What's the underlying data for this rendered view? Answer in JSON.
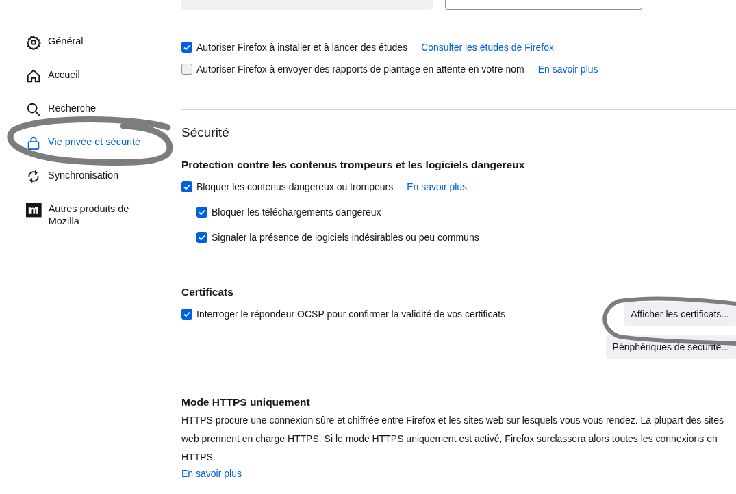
{
  "sidebar": {
    "items": [
      {
        "label": "Général",
        "kind": "gear",
        "selected": false
      },
      {
        "label": "Accueil",
        "kind": "home",
        "selected": false
      },
      {
        "label": "Recherche",
        "kind": "search",
        "selected": false
      },
      {
        "label": "Vie privée et sécurité",
        "kind": "lock",
        "selected": true
      },
      {
        "label": "Synchronisation",
        "kind": "sync",
        "selected": false
      },
      {
        "label": "Autres produits de Mozilla",
        "kind": "mozilla",
        "selected": false
      }
    ]
  },
  "data_collection": {
    "options": [
      {
        "label": "Autoriser Firefox à installer et à lancer des études",
        "checked": true,
        "link": "Consulter les études de Firefox"
      },
      {
        "label": "Autoriser Firefox à envoyer des rapports de plantage en attente en votre nom",
        "checked": false,
        "link": "En savoir plus"
      }
    ]
  },
  "security": {
    "title": "Sécurité",
    "protection": {
      "heading": "Protection contre les contenus trompeurs et les logiciels dangereux",
      "option": {
        "label": "Bloquer les contenus dangereux ou trompeurs",
        "checked": true,
        "link": "En savoir plus"
      },
      "children": [
        {
          "label": "Bloquer les téléchargements dangereux",
          "checked": true
        },
        {
          "label": "Signaler la présence de logiciels indésirables ou peu communs",
          "checked": true
        }
      ]
    },
    "certificates": {
      "heading": "Certificats",
      "option": {
        "label": "Interroger le répondeur OCSP pour confirmer la validité de vos certificats",
        "checked": true
      },
      "buttons": [
        "Afficher les certificats...",
        "Périphériques de sécurité..."
      ]
    },
    "https_only": {
      "heading": "Mode HTTPS uniquement",
      "text": "HTTPS procure une connexion sûre et chiffrée entre Firefox et les sites web sur lesquels vous vous rendez. La plupart des sites web prennent en charge HTTPS. Si le mode HTTPS uniquement est activé, Firefox surclassera alors toutes les connexions en HTTPS.",
      "link": "En savoir plus"
    }
  }
}
